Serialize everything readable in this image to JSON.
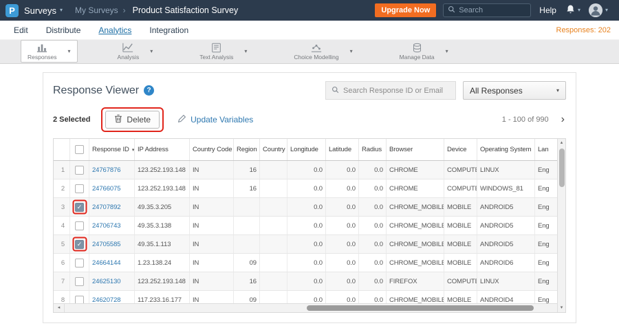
{
  "icons": {
    "chevron_down": "▾",
    "chevron_up": "▴",
    "chevron_left": "◂",
    "chevron_right": "›",
    "breadcrumb_separator": "›",
    "check": "✓",
    "question_mark": "?"
  },
  "topbar": {
    "logo_letter": "P",
    "brand": "Surveys",
    "breadcrumb": "My Surveys",
    "title": "Product Satisfaction Survey",
    "upgrade_label": "Upgrade Now",
    "search_placeholder": "Search",
    "help_label": "Help"
  },
  "nav": {
    "tabs": [
      {
        "label": "Edit",
        "active": false
      },
      {
        "label": "Distribute",
        "active": false
      },
      {
        "label": "Analytics",
        "active": true
      },
      {
        "label": "Integration",
        "active": false
      }
    ],
    "responses_count_label": "Responses: 202"
  },
  "toolbar": {
    "items": [
      {
        "label": "Responses",
        "icon": "responses-icon",
        "active": true
      },
      {
        "label": "Analysis",
        "icon": "analysis-icon",
        "active": false
      },
      {
        "label": "Text Analysis",
        "icon": "text-analysis-icon",
        "active": false
      },
      {
        "label": "Choice Modelling",
        "icon": "choice-modelling-icon",
        "active": false
      },
      {
        "label": "Manage Data",
        "icon": "manage-data-icon",
        "active": false
      }
    ]
  },
  "viewer": {
    "title": "Response Viewer",
    "search_placeholder": "Search Response ID or Email",
    "filter_value": "All Responses",
    "selected_label": "2 Selected",
    "delete_label": "Delete",
    "update_variables_label": "Update Variables",
    "pagination_label": "1 - 100 of 990"
  },
  "table": {
    "columns": [
      "Response ID",
      "IP Address",
      "Country Code",
      "Region",
      "Country",
      "Longitude",
      "Latitude",
      "Radius",
      "Browser",
      "Device",
      "Operating System",
      "Lan"
    ],
    "rows": [
      {
        "num": "1",
        "checked": false,
        "highlighted": false,
        "cells": [
          "24767876",
          "123.252.193.148",
          "IN",
          "16",
          "",
          "0.0",
          "0.0",
          "0.0",
          "CHROME",
          "COMPUTER",
          "LINUX",
          "Eng"
        ]
      },
      {
        "num": "2",
        "checked": false,
        "highlighted": false,
        "cells": [
          "24766075",
          "123.252.193.148",
          "IN",
          "16",
          "",
          "0.0",
          "0.0",
          "0.0",
          "CHROME",
          "COMPUTER",
          "WINDOWS_81",
          "Eng"
        ]
      },
      {
        "num": "3",
        "checked": true,
        "highlighted": true,
        "cells": [
          "24707892",
          "49.35.3.205",
          "IN",
          "",
          "",
          "0.0",
          "0.0",
          "0.0",
          "CHROME_MOBILE",
          "MOBILE",
          "ANDROID5",
          "Eng"
        ]
      },
      {
        "num": "4",
        "checked": false,
        "highlighted": false,
        "cells": [
          "24706743",
          "49.35.3.138",
          "IN",
          "",
          "",
          "0.0",
          "0.0",
          "0.0",
          "CHROME_MOBILE",
          "MOBILE",
          "ANDROID5",
          "Eng"
        ]
      },
      {
        "num": "5",
        "checked": true,
        "highlighted": true,
        "cells": [
          "24705585",
          "49.35.1.113",
          "IN",
          "",
          "",
          "0.0",
          "0.0",
          "0.0",
          "CHROME_MOBILE",
          "MOBILE",
          "ANDROID5",
          "Eng"
        ]
      },
      {
        "num": "6",
        "checked": false,
        "highlighted": false,
        "cells": [
          "24664144",
          "1.23.138.24",
          "IN",
          "09",
          "",
          "0.0",
          "0.0",
          "0.0",
          "CHROME_MOBILE",
          "MOBILE",
          "ANDROID6",
          "Eng"
        ]
      },
      {
        "num": "7",
        "checked": false,
        "highlighted": false,
        "cells": [
          "24625130",
          "123.252.193.148",
          "IN",
          "16",
          "",
          "0.0",
          "0.0",
          "0.0",
          "FIREFOX",
          "COMPUTER",
          "LINUX",
          "Eng"
        ]
      },
      {
        "num": "8",
        "checked": false,
        "highlighted": false,
        "cells": [
          "24620728",
          "117.233.16.177",
          "IN",
          "09",
          "",
          "0.0",
          "0.0",
          "0.0",
          "CHROME_MOBILE",
          "MOBILE",
          "ANDROID4",
          "Eng"
        ]
      }
    ]
  },
  "colors": {
    "topbar_bg": "#2c3b4d",
    "accent_orange": "#f26d21",
    "link_blue": "#2e78b0",
    "annotation_red": "#e1251b"
  }
}
